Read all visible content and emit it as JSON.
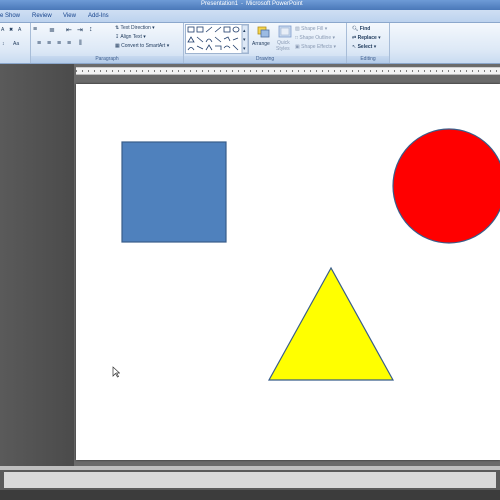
{
  "window": {
    "title_doc": "Presentation1",
    "title_app": "Microsoft PowerPoint"
  },
  "tabs": [
    "e Show",
    "Review",
    "View",
    "Add-Ins"
  ],
  "ribbon": {
    "paragraph": {
      "label": "Paragraph",
      "text_direction": "Text Direction",
      "align_text": "Align Text",
      "convert_smartart": "Convert to SmartArt"
    },
    "drawing": {
      "label": "Drawing",
      "arrange": "Arrange",
      "quick_styles_1": "Quick",
      "quick_styles_2": "Styles",
      "shape_fill": "Shape Fill",
      "shape_outline": "Shape Outline",
      "shape_effects": "Shape Effects"
    },
    "editing": {
      "label": "Editing",
      "find": "Find",
      "replace": "Replace",
      "select": "Select"
    }
  },
  "slide": {
    "shapes": [
      {
        "kind": "rectangle",
        "fill": "#4f81bd",
        "stroke": "#385d8a"
      },
      {
        "kind": "ellipse",
        "fill": "#ff0000",
        "stroke": "#385d8a"
      },
      {
        "kind": "triangle",
        "fill": "#ffff00",
        "stroke": "#385d8a"
      }
    ]
  },
  "colors": {
    "ribbon_bg": "#dce8f6",
    "title_bar": "#4a78b8",
    "workspace": "#6b6b6b"
  }
}
